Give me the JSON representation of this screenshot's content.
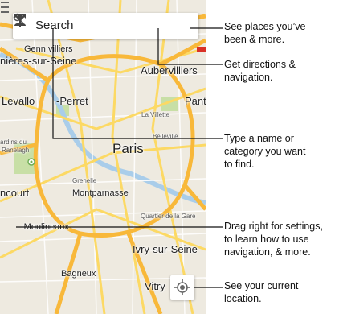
{
  "search": {
    "placeholder": "Search"
  },
  "map": {
    "places": [
      "Genn villiers",
      "nières-sur-Seine",
      "Aubervilliers",
      "Levallo",
      "-Perret",
      "Panti",
      "La Villette",
      "Belleville",
      "ardins du",
      "Ranelagh",
      "Paris",
      "Grenelle",
      "Montparnasse",
      "ncourt",
      "Quartier de la Gare",
      "-Moulineaux",
      "Ivry-sur-Seine",
      "Bagneux",
      "Vitry"
    ],
    "colors": {
      "background": "#eeeae0",
      "highway": "#f8b83a",
      "arterial": "#fcd964",
      "park": "#c8dfa6",
      "water": "#a9cdea"
    }
  },
  "callouts": [
    {
      "lines": [
        "See places you’ve",
        "been & more."
      ]
    },
    {
      "lines": [
        "Get directions &",
        "navigation."
      ]
    },
    {
      "lines": [
        "Type a name or",
        "category you want",
        "to find."
      ]
    },
    {
      "lines": [
        "Drag right for settings,",
        "to learn how to use",
        "navigation, & more."
      ]
    },
    {
      "lines": [
        "See your current",
        "location."
      ]
    }
  ],
  "icons": {
    "search": "search-icon",
    "directions": "directions-icon",
    "account": "person-icon",
    "menu": "menu-icon",
    "location": "my-location-icon"
  }
}
